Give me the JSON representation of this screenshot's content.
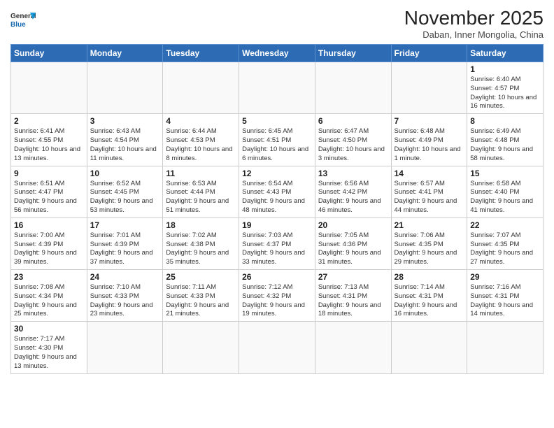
{
  "header": {
    "logo_general": "General",
    "logo_blue": "Blue",
    "month_title": "November 2025",
    "location": "Daban, Inner Mongolia, China"
  },
  "weekdays": [
    "Sunday",
    "Monday",
    "Tuesday",
    "Wednesday",
    "Thursday",
    "Friday",
    "Saturday"
  ],
  "weeks": [
    [
      {
        "day": "",
        "info": ""
      },
      {
        "day": "",
        "info": ""
      },
      {
        "day": "",
        "info": ""
      },
      {
        "day": "",
        "info": ""
      },
      {
        "day": "",
        "info": ""
      },
      {
        "day": "",
        "info": ""
      },
      {
        "day": "1",
        "info": "Sunrise: 6:40 AM\nSunset: 4:57 PM\nDaylight: 10 hours and 16 minutes."
      }
    ],
    [
      {
        "day": "2",
        "info": "Sunrise: 6:41 AM\nSunset: 4:55 PM\nDaylight: 10 hours and 13 minutes."
      },
      {
        "day": "3",
        "info": "Sunrise: 6:43 AM\nSunset: 4:54 PM\nDaylight: 10 hours and 11 minutes."
      },
      {
        "day": "4",
        "info": "Sunrise: 6:44 AM\nSunset: 4:53 PM\nDaylight: 10 hours and 8 minutes."
      },
      {
        "day": "5",
        "info": "Sunrise: 6:45 AM\nSunset: 4:51 PM\nDaylight: 10 hours and 6 minutes."
      },
      {
        "day": "6",
        "info": "Sunrise: 6:47 AM\nSunset: 4:50 PM\nDaylight: 10 hours and 3 minutes."
      },
      {
        "day": "7",
        "info": "Sunrise: 6:48 AM\nSunset: 4:49 PM\nDaylight: 10 hours and 1 minute."
      },
      {
        "day": "8",
        "info": "Sunrise: 6:49 AM\nSunset: 4:48 PM\nDaylight: 9 hours and 58 minutes."
      }
    ],
    [
      {
        "day": "9",
        "info": "Sunrise: 6:51 AM\nSunset: 4:47 PM\nDaylight: 9 hours and 56 minutes."
      },
      {
        "day": "10",
        "info": "Sunrise: 6:52 AM\nSunset: 4:45 PM\nDaylight: 9 hours and 53 minutes."
      },
      {
        "day": "11",
        "info": "Sunrise: 6:53 AM\nSunset: 4:44 PM\nDaylight: 9 hours and 51 minutes."
      },
      {
        "day": "12",
        "info": "Sunrise: 6:54 AM\nSunset: 4:43 PM\nDaylight: 9 hours and 48 minutes."
      },
      {
        "day": "13",
        "info": "Sunrise: 6:56 AM\nSunset: 4:42 PM\nDaylight: 9 hours and 46 minutes."
      },
      {
        "day": "14",
        "info": "Sunrise: 6:57 AM\nSunset: 4:41 PM\nDaylight: 9 hours and 44 minutes."
      },
      {
        "day": "15",
        "info": "Sunrise: 6:58 AM\nSunset: 4:40 PM\nDaylight: 9 hours and 41 minutes."
      }
    ],
    [
      {
        "day": "16",
        "info": "Sunrise: 7:00 AM\nSunset: 4:39 PM\nDaylight: 9 hours and 39 minutes."
      },
      {
        "day": "17",
        "info": "Sunrise: 7:01 AM\nSunset: 4:39 PM\nDaylight: 9 hours and 37 minutes."
      },
      {
        "day": "18",
        "info": "Sunrise: 7:02 AM\nSunset: 4:38 PM\nDaylight: 9 hours and 35 minutes."
      },
      {
        "day": "19",
        "info": "Sunrise: 7:03 AM\nSunset: 4:37 PM\nDaylight: 9 hours and 33 minutes."
      },
      {
        "day": "20",
        "info": "Sunrise: 7:05 AM\nSunset: 4:36 PM\nDaylight: 9 hours and 31 minutes."
      },
      {
        "day": "21",
        "info": "Sunrise: 7:06 AM\nSunset: 4:35 PM\nDaylight: 9 hours and 29 minutes."
      },
      {
        "day": "22",
        "info": "Sunrise: 7:07 AM\nSunset: 4:35 PM\nDaylight: 9 hours and 27 minutes."
      }
    ],
    [
      {
        "day": "23",
        "info": "Sunrise: 7:08 AM\nSunset: 4:34 PM\nDaylight: 9 hours and 25 minutes."
      },
      {
        "day": "24",
        "info": "Sunrise: 7:10 AM\nSunset: 4:33 PM\nDaylight: 9 hours and 23 minutes."
      },
      {
        "day": "25",
        "info": "Sunrise: 7:11 AM\nSunset: 4:33 PM\nDaylight: 9 hours and 21 minutes."
      },
      {
        "day": "26",
        "info": "Sunrise: 7:12 AM\nSunset: 4:32 PM\nDaylight: 9 hours and 19 minutes."
      },
      {
        "day": "27",
        "info": "Sunrise: 7:13 AM\nSunset: 4:31 PM\nDaylight: 9 hours and 18 minutes."
      },
      {
        "day": "28",
        "info": "Sunrise: 7:14 AM\nSunset: 4:31 PM\nDaylight: 9 hours and 16 minutes."
      },
      {
        "day": "29",
        "info": "Sunrise: 7:16 AM\nSunset: 4:31 PM\nDaylight: 9 hours and 14 minutes."
      }
    ],
    [
      {
        "day": "30",
        "info": "Sunrise: 7:17 AM\nSunset: 4:30 PM\nDaylight: 9 hours and 13 minutes."
      },
      {
        "day": "",
        "info": ""
      },
      {
        "day": "",
        "info": ""
      },
      {
        "day": "",
        "info": ""
      },
      {
        "day": "",
        "info": ""
      },
      {
        "day": "",
        "info": ""
      },
      {
        "day": "",
        "info": ""
      }
    ]
  ]
}
